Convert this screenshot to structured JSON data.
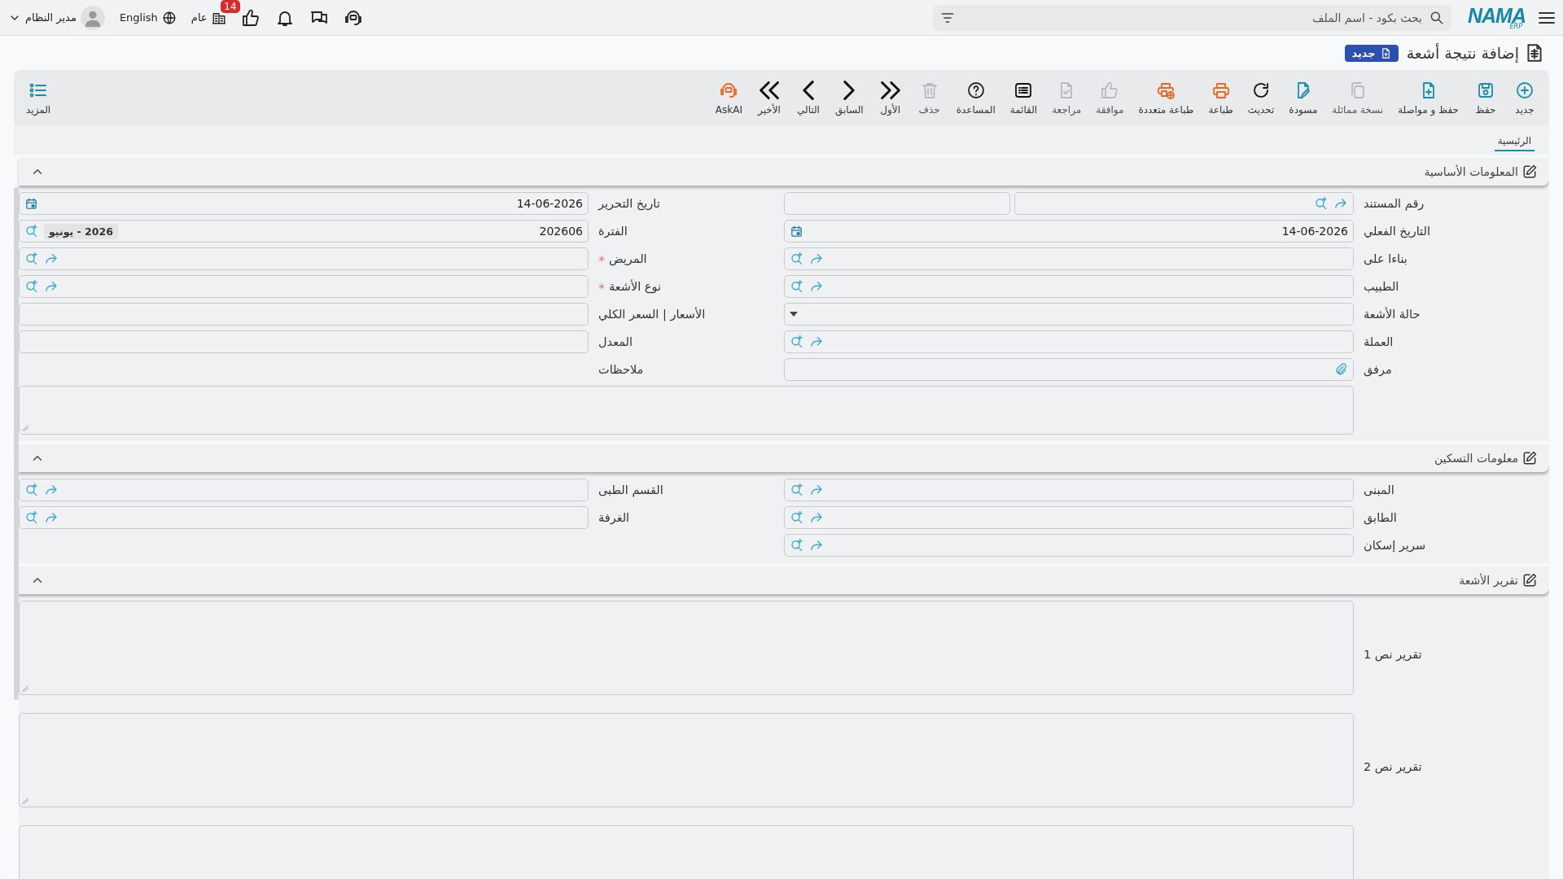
{
  "topbar": {
    "logo": {
      "name": "NAMA",
      "sub": "ERP"
    },
    "search": {
      "placeholder": "بحث بكود - اسم الملف"
    },
    "actions": [
      {
        "kind": "ai"
      },
      {
        "kind": "chat"
      },
      {
        "kind": "bell"
      },
      {
        "kind": "like",
        "badge": "14"
      },
      {
        "kind": "company",
        "label": "عام"
      },
      {
        "kind": "language",
        "label": "English"
      },
      {
        "kind": "user",
        "label": "مدير النظام"
      }
    ]
  },
  "page": {
    "title": "إضافة نتيجة أشعة",
    "badge": "جديد"
  },
  "toolbar": [
    {
      "kind": "new",
      "label": "جديد",
      "disabled": false
    },
    {
      "kind": "save",
      "label": "حفظ",
      "disabled": false
    },
    {
      "kind": "save-continue",
      "label": "حفظ و مواصلة",
      "disabled": false
    },
    {
      "kind": "duplicate",
      "label": "نسخة مماثلة",
      "disabled": true
    },
    {
      "kind": "draft",
      "label": "مسودة",
      "disabled": false
    },
    {
      "kind": "refresh",
      "label": "تحديث",
      "disabled": false
    },
    {
      "kind": "print",
      "label": "طباعة",
      "disabled": false
    },
    {
      "kind": "multi-print",
      "label": "طباعة متعددة",
      "disabled": false
    },
    {
      "kind": "approve",
      "label": "موافقة",
      "disabled": true
    },
    {
      "kind": "review",
      "label": "مراجعة",
      "disabled": true
    },
    {
      "kind": "list",
      "label": "القائمة",
      "disabled": false
    },
    {
      "kind": "help",
      "label": "المساعدة",
      "disabled": false
    },
    {
      "kind": "delete",
      "label": "حذف",
      "disabled": true
    },
    {
      "kind": "first",
      "label": "الأول",
      "disabled": false
    },
    {
      "kind": "previous",
      "label": "السابق",
      "disabled": false
    },
    {
      "kind": "next",
      "label": "التالي",
      "disabled": false
    },
    {
      "kind": "last",
      "label": "الأخير",
      "disabled": false
    },
    {
      "kind": "askai",
      "label": "AskAI",
      "disabled": false
    }
  ],
  "more": {
    "label": "المزيد"
  },
  "tabs": [
    {
      "label": "الرئيسية",
      "selected": true
    }
  ],
  "sections": [
    {
      "title": "المعلومات الأساسية",
      "expanded": true,
      "fields": [
        {
          "label": "رقم المستند",
          "kind": "docnumber",
          "required": false
        },
        {
          "label": "تاريخ التحرير",
          "kind": "date",
          "value": "14-06-2026",
          "required": false
        },
        {
          "label": "التاريخ الفعلي",
          "kind": "date",
          "value": "14-06-2026",
          "required": false
        },
        {
          "label": "الفترة",
          "kind": "period",
          "value": "202606",
          "chip": "2026 - يونيو",
          "required": false
        },
        {
          "label": "بناءا على",
          "kind": "lookup",
          "required": false
        },
        {
          "label": "المريض",
          "kind": "lookup",
          "required": true
        },
        {
          "label": "الطبيب",
          "kind": "lookup",
          "required": false
        },
        {
          "label": "نوع الأشعة",
          "kind": "lookup",
          "required": true
        },
        {
          "label": "حالة الأشعة",
          "kind": "select",
          "required": false
        },
        {
          "label": "الأسعار | السعر الكلي",
          "kind": "text",
          "required": false
        },
        {
          "label": "العملة",
          "kind": "lookup",
          "required": false
        },
        {
          "label": "المعدل",
          "kind": "text",
          "required": false
        },
        {
          "label": "مرفق",
          "kind": "file",
          "required": false
        },
        {
          "label": "ملاحظات",
          "kind": "notes",
          "required": false
        }
      ]
    },
    {
      "title": "معلومات التسكين",
      "expanded": true,
      "fields": [
        {
          "label": "المبنى",
          "kind": "lookup",
          "required": false
        },
        {
          "label": "القسم الطبى",
          "kind": "lookup",
          "required": false
        },
        {
          "label": "الطابق",
          "kind": "lookup",
          "required": false
        },
        {
          "label": "الغرفة",
          "kind": "lookup",
          "required": false
        },
        {
          "label": "سرير إسكان",
          "kind": "lookup",
          "required": false
        }
      ]
    },
    {
      "title": "تقرير الأشعة",
      "expanded": true,
      "fields": [
        {
          "label": "تقرير نص 1",
          "kind": "report",
          "required": false
        },
        {
          "label": "تقرير نص 2",
          "kind": "report",
          "required": false
        },
        {
          "kind": "report",
          "required": false
        }
      ]
    }
  ]
}
